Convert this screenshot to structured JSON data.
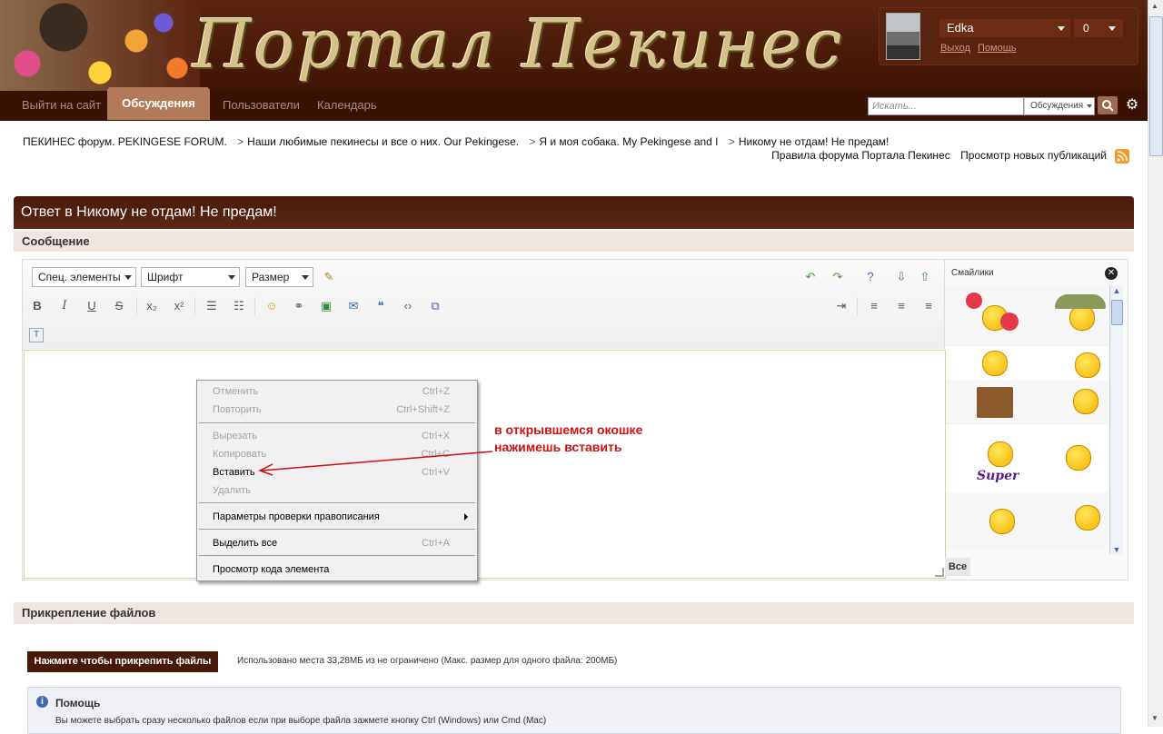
{
  "header": {
    "logo_text": "Портал Пекинес",
    "user": {
      "name": "Edka",
      "notifications": "0",
      "logout": "Выход",
      "help": "Помощь"
    }
  },
  "nav": {
    "items": [
      {
        "label": "Выйти на сайт"
      },
      {
        "label": "Обсуждения",
        "active": true
      },
      {
        "label": "Пользователи"
      },
      {
        "label": "Календарь"
      }
    ],
    "search_placeholder": "Искать...",
    "search_scope": "Обсуждения"
  },
  "breadcrumb": [
    "ПЕКИНЕС форум. PEKINGESE FORUM.",
    "Наши любимые пекинесы и все о них. Our  Pekingese.",
    "Я и моя собака. My Pekingese and I",
    "Никому не отдам! Не предам!"
  ],
  "links": {
    "rules": "Правила форума Портала Пекинес",
    "new_posts": "Просмотр новых публикаций"
  },
  "reply": {
    "title": "Ответ в Никому не отдам! Не предам!",
    "message_section": "Сообщение",
    "attach_section": "Прикрепление файлов"
  },
  "toolbar": {
    "special": "Спец. элементы",
    "font": "Шрифт",
    "size": "Размер"
  },
  "smileys": {
    "title": "Смайлики",
    "all": "Все",
    "super_caption": "Super"
  },
  "context_menu": [
    {
      "label": "Отменить",
      "shortcut": "Ctrl+Z",
      "enabled": false
    },
    {
      "label": "Повторить",
      "shortcut": "Ctrl+Shift+Z",
      "enabled": false
    },
    {
      "label": "Вырезать",
      "shortcut": "Ctrl+X",
      "enabled": false
    },
    {
      "label": "Копировать",
      "shortcut": "Ctrl+C",
      "enabled": false
    },
    {
      "label": "Вставить",
      "shortcut": "Ctrl+V",
      "enabled": true
    },
    {
      "label": "Удалить",
      "shortcut": "",
      "enabled": false
    },
    {
      "label": "Параметры проверки правописания",
      "shortcut": "",
      "enabled": true,
      "submenu": true
    },
    {
      "label": "Выделить все",
      "shortcut": "Ctrl+A",
      "enabled": true
    },
    {
      "label": "Просмотр кода элемента",
      "shortcut": "",
      "enabled": true
    }
  ],
  "annotation": {
    "line1": "в открывшемся окошке",
    "line2": "нажимешь вставить"
  },
  "attach": {
    "button": "Нажмите чтобы прикрепить файлы",
    "info": "Использовано места 33,28МБ из не ограничено (Макс. размер для одного файла: 200МБ)"
  },
  "help": {
    "title": "Помощь",
    "text": "Вы можете выбрать сразу несколько файлов если при выборе файла зажмете кнопку Ctrl (Windows) или Cmd (Mac)"
  }
}
